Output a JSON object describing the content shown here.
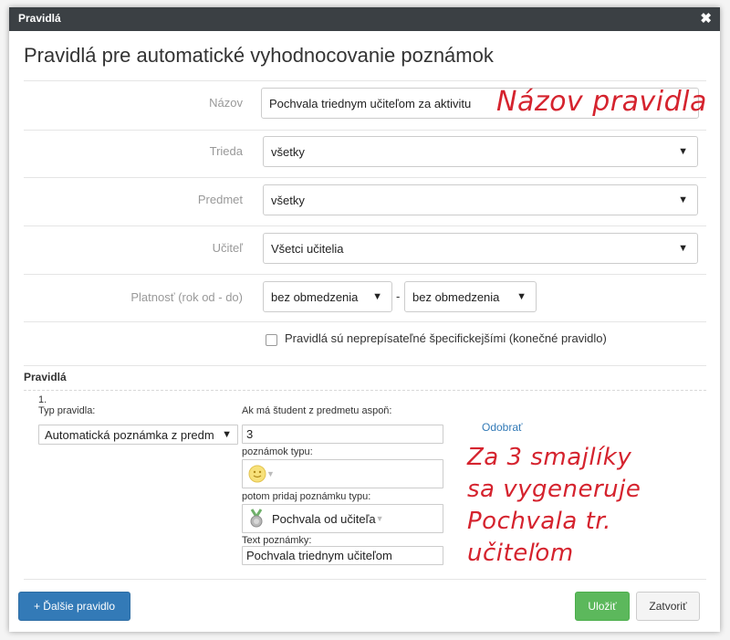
{
  "window": {
    "title": "Pravidlá",
    "close_glyph": "✖"
  },
  "heading": "Pravidlá pre automatické vyhodnocovanie poznámok",
  "form": {
    "nazov_label": "Názov",
    "nazov_value": "Pochvala triednym učiteľom za aktivitu",
    "trieda_label": "Trieda",
    "trieda_value": "všetky",
    "predmet_label": "Predmet",
    "predmet_value": "všetky",
    "ucitel_label": "Učiteľ",
    "ucitel_value": "Všetci učitelia",
    "platnost_label": "Platnosť (rok od - do)",
    "platnost_from": "bez obmedzenia",
    "platnost_sep": "-",
    "platnost_to": "bez obmedzenia",
    "final_checkbox_label": "Pravidlá sú neprepísateľné špecifickejšími (konečné pravidlo)",
    "final_checkbox_checked": false
  },
  "rules_section": {
    "title": "Pravidlá",
    "rule": {
      "number": "1.",
      "type_label": "Typ pravidla:",
      "type_value": "Automatická poznámka z predm",
      "count_label": "Ak má študent z predmetu aspoň:",
      "count_value": "3",
      "note_type_label": "poznámok typu:",
      "note_type_icon": "smiley-icon",
      "then_label": "potom pridaj poznámku typu:",
      "then_icon": "medal-icon",
      "then_value": "Pochvala od učiteľa",
      "text_label": "Text poznámky:",
      "text_value": "Pochvala triednym učiteľom",
      "remove_link": "Odobrať"
    }
  },
  "annotations": {
    "name_note": "Názov pravidla",
    "rule_note_lines": [
      "Za 3 smajlíky",
      "sa vygeneruje",
      "Pochvala tr. učiteľom"
    ]
  },
  "footer": {
    "add_rule": "+ Ďalšie pravidlo",
    "save": "Uložiť",
    "close": "Zatvoriť"
  },
  "colors": {
    "titlebar": "#3b4044",
    "primary": "#337ab7",
    "success": "#5cb85c",
    "annotation": "#d5232e"
  }
}
